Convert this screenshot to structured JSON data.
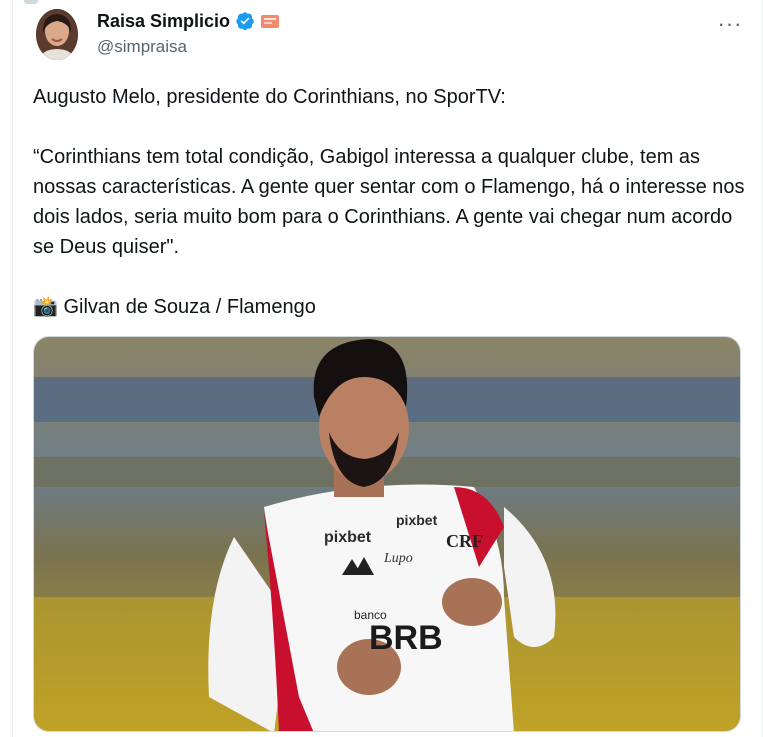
{
  "author": {
    "display_name": "Raisa Simplicio",
    "handle": "@simpraisa",
    "verified_icon": "verified-badge-icon",
    "flag_icon": "flag-emoji-icon"
  },
  "menu": {
    "more_label": "···"
  },
  "tweet": {
    "line1": "Augusto Melo, presidente do Corinthians, no SporTV:",
    "quote": "“Corinthians tem total condição, Gabigol interessa a qualquer clube, tem as nossas características. A gente quer sentar com o Flamengo, há o interesse nos dois lados, seria muito bom para o Corinthians. A gente vai chegar num acordo se Deus quiser\".",
    "credit": "📸 Gilvan de Souza / Flamengo"
  },
  "photo": {
    "shirt_sponsor_1": "pixbet",
    "shirt_sponsor_2": "pixbet",
    "shirt_brand": "Lupo",
    "bank_small": "banco",
    "bank_big": "BRB",
    "crest": "CRF"
  },
  "colors": {
    "text": "#0f1419",
    "secondary": "#536471",
    "verified": "#1d9bf0",
    "shirt_red": "#c8102e"
  }
}
